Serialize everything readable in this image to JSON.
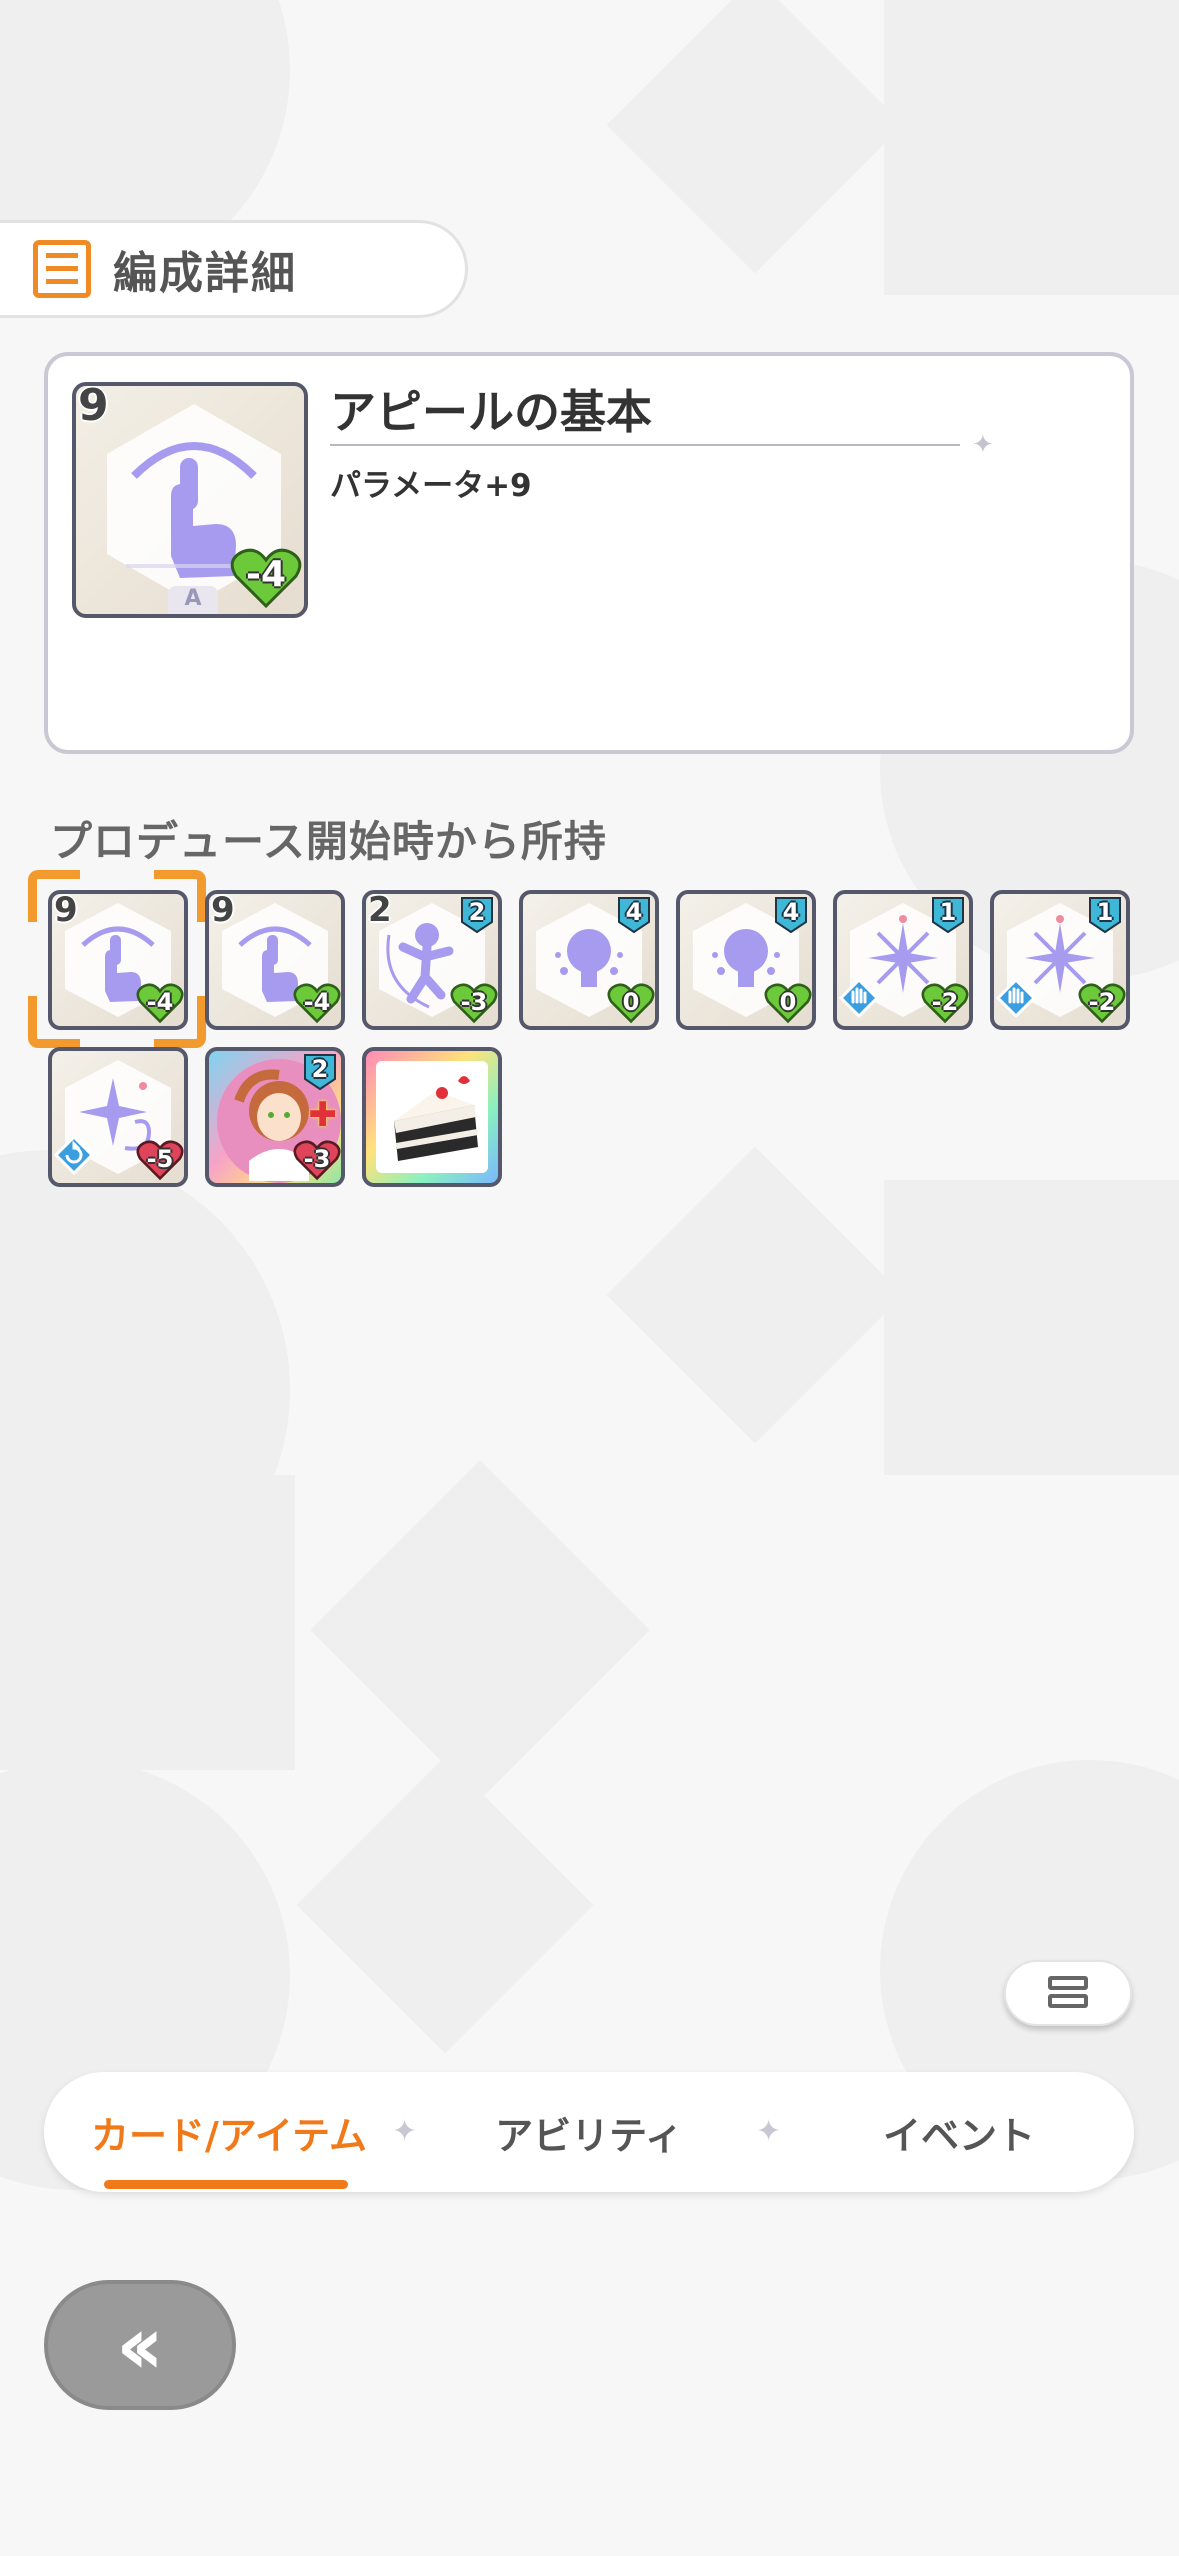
{
  "header": {
    "title": "編成詳細",
    "icon": "list-icon"
  },
  "detail": {
    "cost": "9",
    "name": "アピールの基本",
    "param": "パラメータ+9",
    "heart_value": "-4",
    "grade_letter": "A"
  },
  "section_label": "プロデュース開始時から所持",
  "cards": [
    {
      "cost": "9",
      "heart": "-4",
      "badge": "",
      "selected": true,
      "art": "hand-tap-icon"
    },
    {
      "cost": "9",
      "heart": "-4",
      "badge": "",
      "art": "hand-tap-icon"
    },
    {
      "cost": "2",
      "heart": "-3",
      "badge": "2",
      "art": "jump-figure-icon"
    },
    {
      "cost": "",
      "heart": "0",
      "badge": "4",
      "art": "lightbulb-icon"
    },
    {
      "cost": "",
      "heart": "0",
      "badge": "4",
      "art": "lightbulb-icon"
    },
    {
      "cost": "",
      "heart": "-2",
      "badge": "1",
      "art": "sparkle-burst-icon",
      "diamond": "hand-icon"
    },
    {
      "cost": "",
      "heart": "-2",
      "badge": "1",
      "art": "sparkle-burst-icon",
      "diamond": "hand-icon"
    },
    {
      "cost": "",
      "heart": "-5",
      "badge": "",
      "art": "star-swirl-icon",
      "diamond": "refresh-icon"
    },
    {
      "cost": "",
      "heart": "-3",
      "badge": "2",
      "art": "idol-portrait"
    },
    {
      "cost": "",
      "heart": "",
      "badge": "",
      "art": "cake-item"
    }
  ],
  "tabs": [
    {
      "label": "カード/アイテム",
      "active": true
    },
    {
      "label": "アビリティ"
    },
    {
      "label": "イベント"
    }
  ],
  "back_label": "‹‹",
  "colors": {
    "accent": "#f07a1a",
    "heart_green": "#6cc93a",
    "heart_red": "#e0445a",
    "badge_teal": "#3fb7d6",
    "art_purple": "#a79bf0"
  }
}
